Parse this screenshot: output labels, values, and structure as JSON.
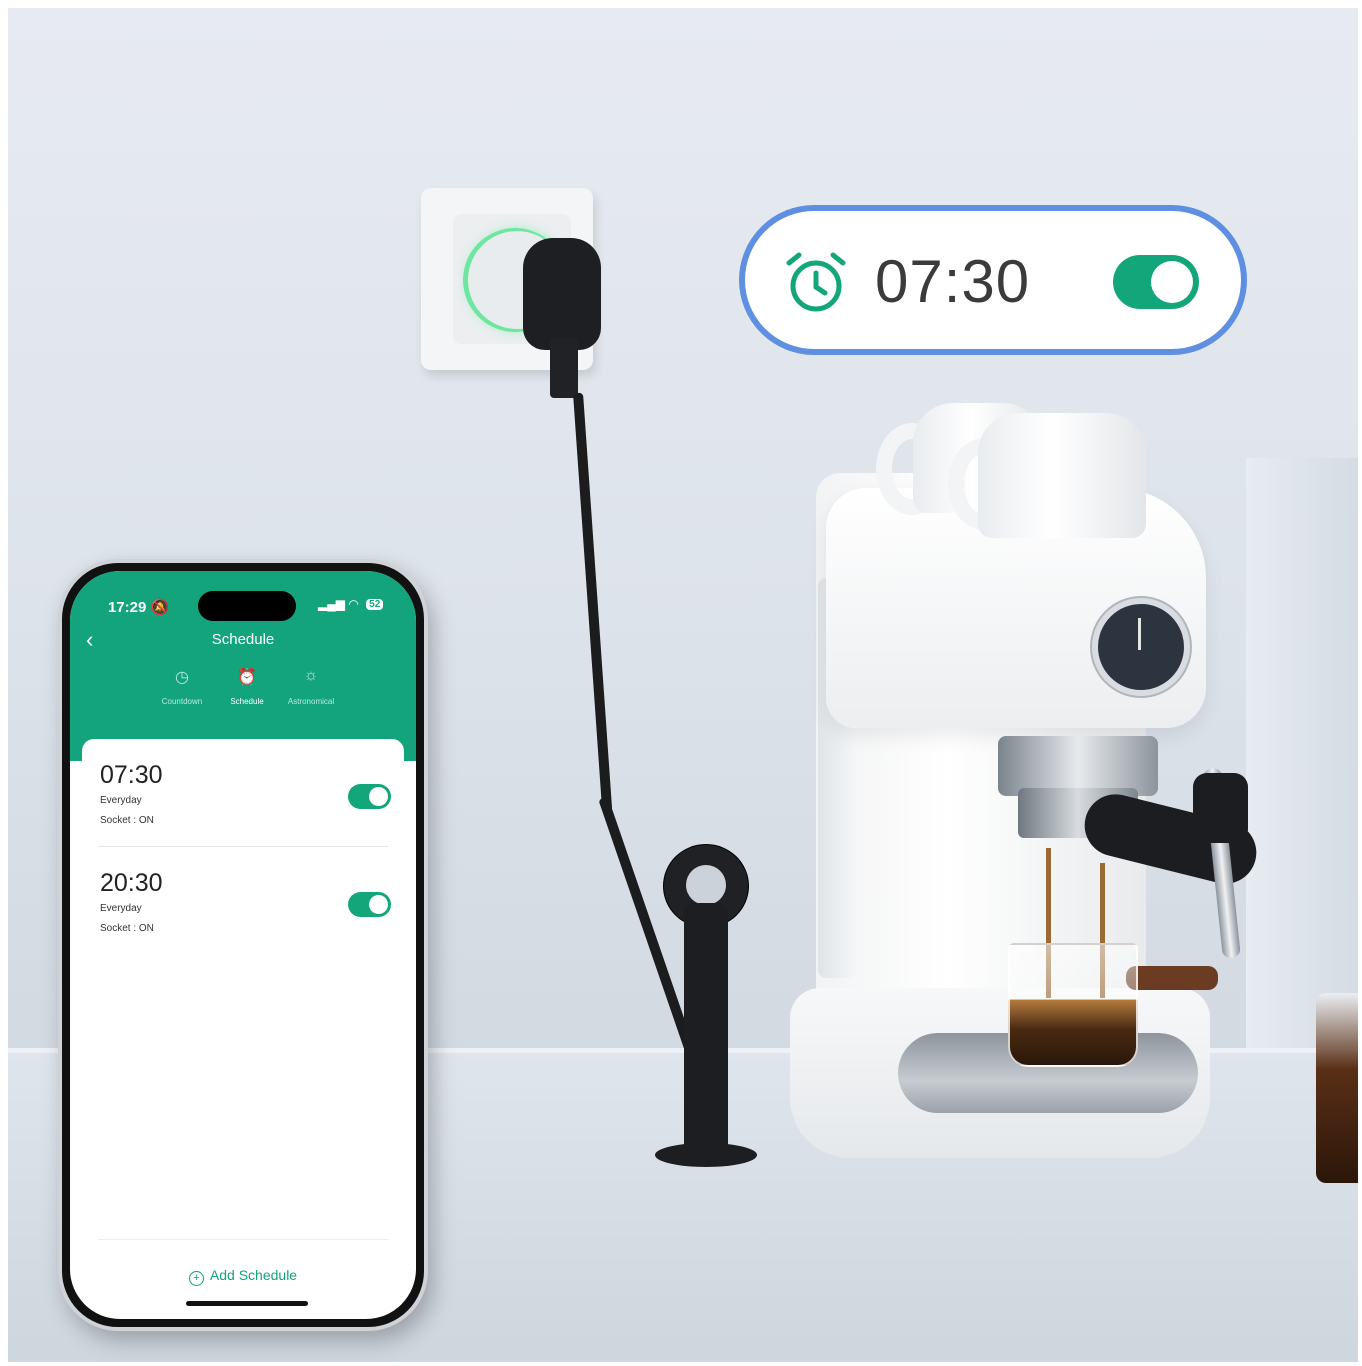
{
  "overlay": {
    "time": "07:30",
    "toggle_on": true,
    "icon": "alarm-clock-icon"
  },
  "phone": {
    "status_bar": {
      "time": "17:29",
      "battery": "52"
    },
    "header": {
      "title": "Schedule",
      "back_icon": "chevron-left-icon"
    },
    "tabs": [
      {
        "label": "Countdown",
        "icon": "clock-icon",
        "active": false
      },
      {
        "label": "Schedule",
        "icon": "alarm-clock-icon",
        "active": true
      },
      {
        "label": "Astronomical",
        "icon": "sunrise-icon",
        "active": false
      }
    ],
    "schedules": [
      {
        "time": "07:30",
        "repeat": "Everyday",
        "action": "Socket : ON",
        "enabled": true
      },
      {
        "time": "20:30",
        "repeat": "Everyday",
        "action": "Socket : ON",
        "enabled": true
      }
    ],
    "add_label": "Add Schedule"
  },
  "colors": {
    "accent": "#13a47c",
    "overlay_border": "#5f8fe0"
  }
}
